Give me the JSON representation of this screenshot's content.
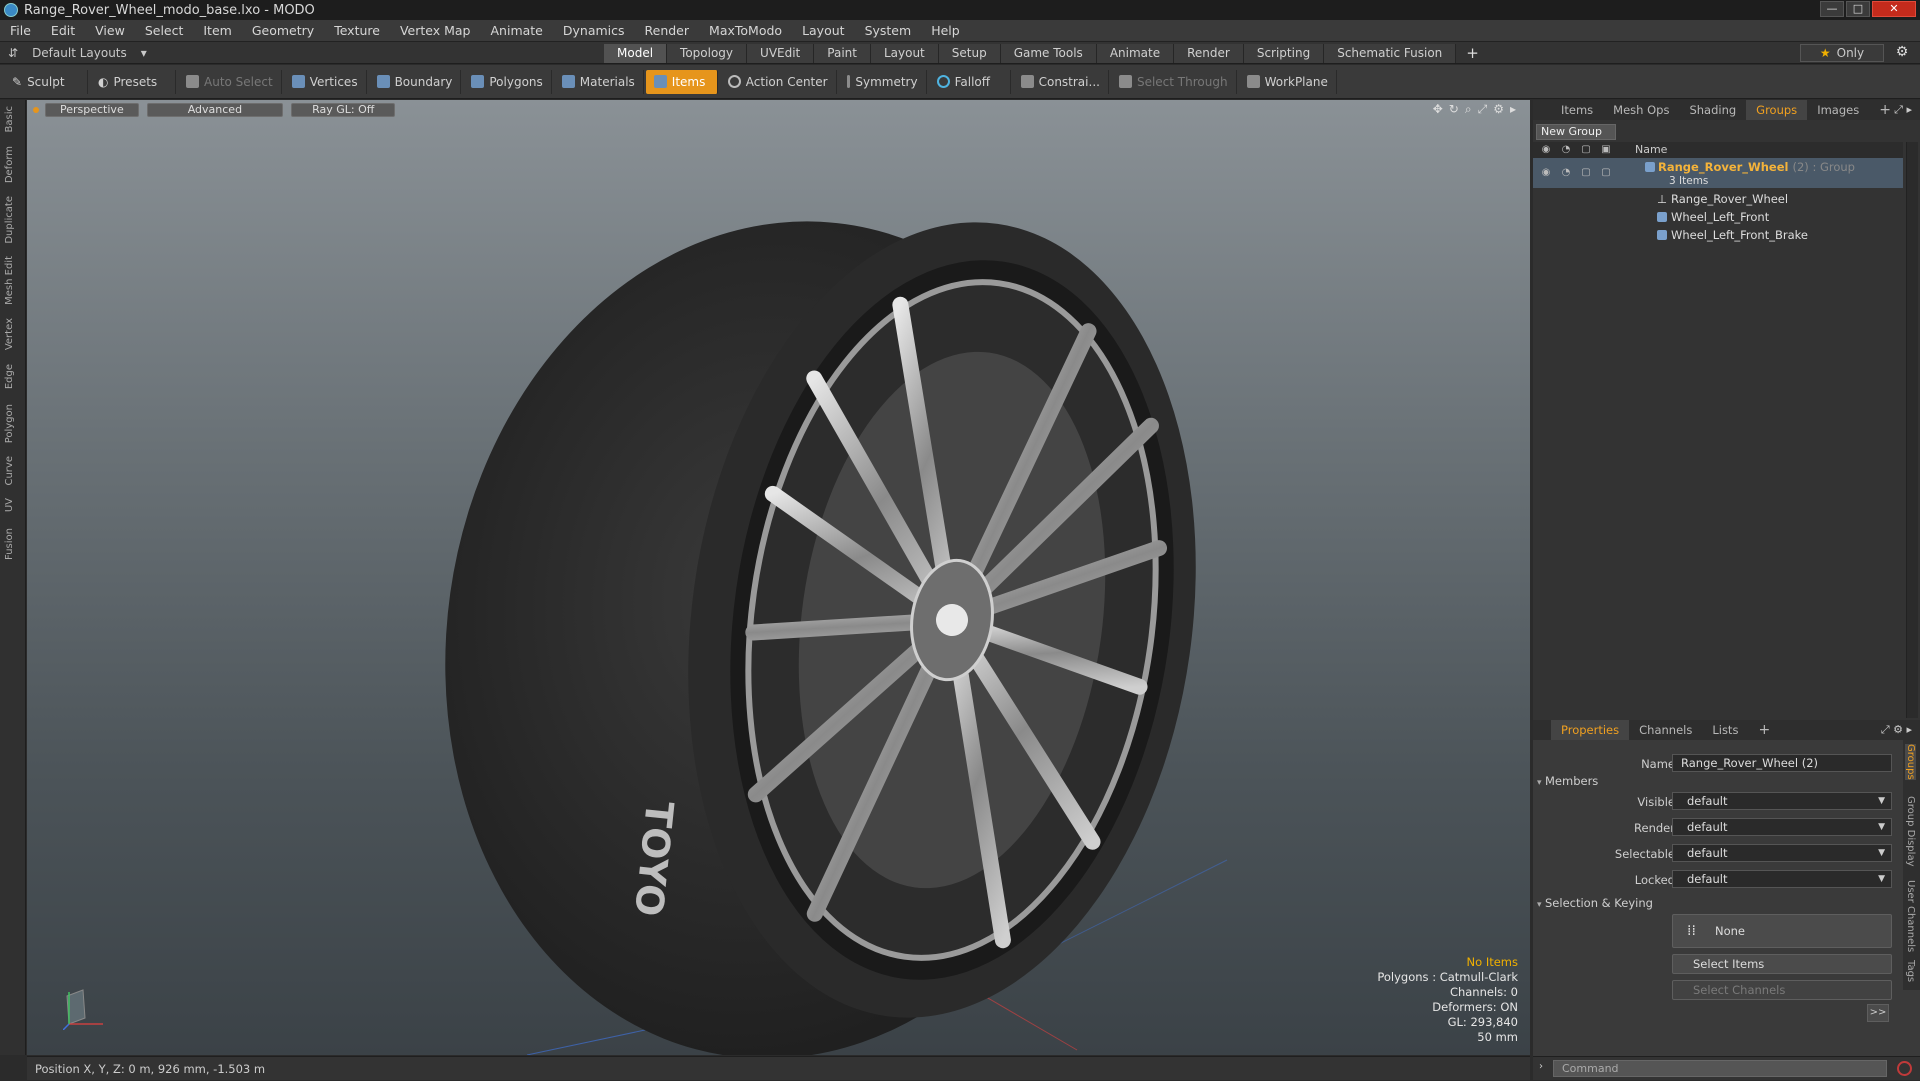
{
  "window": {
    "title": "Range_Rover_Wheel_modo_base.lxo - MODO",
    "buttons": {
      "minimize": "—",
      "maximize": "□",
      "close": "✕"
    }
  },
  "menu": [
    "File",
    "Edit",
    "View",
    "Select",
    "Item",
    "Geometry",
    "Texture",
    "Vertex Map",
    "Animate",
    "Dynamics",
    "Render",
    "MaxToModo",
    "Layout",
    "System",
    "Help"
  ],
  "layout_bar": {
    "picker_label": "Default Layouts",
    "tabs": [
      "Model",
      "Topology",
      "UVEdit",
      "Paint",
      "Layout",
      "Setup",
      "Game Tools",
      "Animate",
      "Render",
      "Scripting",
      "Schematic Fusion"
    ],
    "active_tab": "Model",
    "plus": "+",
    "only_label": "Only"
  },
  "toolbar": {
    "sculpt": "Sculpt",
    "presets": "Presets",
    "auto_select": "Auto Select",
    "vertices": "Vertices",
    "boundary": "Boundary",
    "polygons": "Polygons",
    "materials": "Materials",
    "items": "Items",
    "action_center": "Action Center",
    "symmetry": "Symmetry",
    "falloff": "Falloff",
    "constraints": "Constrai...",
    "select_through": "Select Through",
    "workplane": "WorkPlane"
  },
  "left_tabs": [
    "Basic",
    "Deform",
    "Duplicate",
    "Mesh Edit",
    "Vertex",
    "Edge",
    "Polygon",
    "Curve",
    "UV",
    "Fusion"
  ],
  "viewport": {
    "view": "Perspective",
    "shading": "Advanced",
    "raygl": "Ray GL: Off",
    "info": {
      "selection": "No Items",
      "polygons": "Polygons : Catmull-Clark",
      "channels": "Channels: 0",
      "deformers": "Deformers: ON",
      "gl": "GL: 293,840",
      "grid": "50 mm"
    },
    "tire_brand": "TOYO"
  },
  "status": "Position X, Y, Z:  0 m, 926 mm, -1.503 m",
  "groups_panel": {
    "tabs": [
      "Items",
      "Mesh Ops",
      "Shading",
      "Groups",
      "Images"
    ],
    "active_tab": "Groups",
    "new_group": "New Group",
    "column_name": "Name",
    "group": {
      "name": "Range_Rover_Wheel",
      "suffix": "(2) : Group",
      "count": "3 Items"
    },
    "children": [
      "Range_Rover_Wheel",
      "Wheel_Left_Front",
      "Wheel_Left_Front_Brake"
    ]
  },
  "properties": {
    "tabs": [
      "Properties",
      "Channels",
      "Lists"
    ],
    "active_tab": "Properties",
    "name_label": "Name",
    "name_value": "Range_Rover_Wheel (2)",
    "members_label": "Members",
    "fields": [
      {
        "label": "Visible",
        "value": "default"
      },
      {
        "label": "Render",
        "value": "default"
      },
      {
        "label": "Selectable",
        "value": "default"
      },
      {
        "label": "Locked",
        "value": "default"
      }
    ],
    "selection_label": "Selection & Keying",
    "none_btn": "None",
    "select_items": "Select Items",
    "select_channels": "Select Channels",
    "more": ">>",
    "side_tabs": [
      "Groups",
      "Group Display",
      "User Channels",
      "Tags"
    ]
  },
  "command": {
    "placeholder": "Command"
  },
  "colors": {
    "accent": "#e6951c",
    "group_name": "#f4b33a",
    "selection_row": "#4a5968",
    "info_warning": "#f0b000"
  }
}
